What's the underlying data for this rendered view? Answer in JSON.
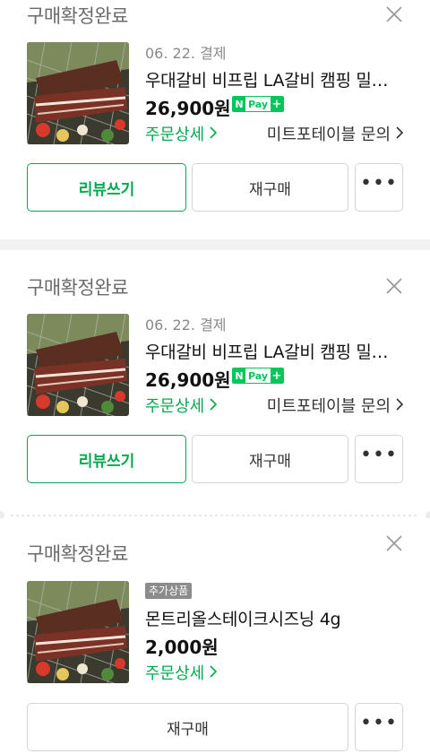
{
  "orders": [
    {
      "status": "구매확정완료",
      "date": "06. 22. 결제",
      "product_name": "우대갈비 비프립 LA갈비 캠핑 밀키트 선물세트",
      "price": "26,900원",
      "npay": {
        "n": "N",
        "pay": "Pay",
        "plus": "+"
      },
      "detail_link": "주문상세",
      "inquiry_link": "미트포테이블 문의",
      "buttons": {
        "review": "리뷰쓰기",
        "rebuy": "재구매",
        "more": "•••"
      }
    },
    {
      "status": "구매확정완료",
      "date": "06. 22. 결제",
      "product_name": "우대갈비 비프립 LA갈비 캠핑 밀키트 선물세트",
      "price": "26,900원",
      "npay": {
        "n": "N",
        "pay": "Pay",
        "plus": "+"
      },
      "detail_link": "주문상세",
      "inquiry_link": "미트포테이블 문의",
      "buttons": {
        "review": "리뷰쓰기",
        "rebuy": "재구매",
        "more": "•••"
      }
    },
    {
      "status": "구매확정완료",
      "tag": "추가상품",
      "product_name": "몬트리올스테이크시즈닝 4g",
      "price": "2,000원",
      "detail_link": "주문상세",
      "buttons": {
        "rebuy": "재구매",
        "more": "•••"
      }
    }
  ],
  "colors": {
    "accent": "#03a94e",
    "npay": "#03c75a",
    "status_text": "#6b6b6b",
    "separator": "#f2f2f2"
  },
  "icons": {
    "close": "close-icon",
    "chevron": "chevron-right-icon",
    "thumbnail": "product-thumbnail"
  }
}
